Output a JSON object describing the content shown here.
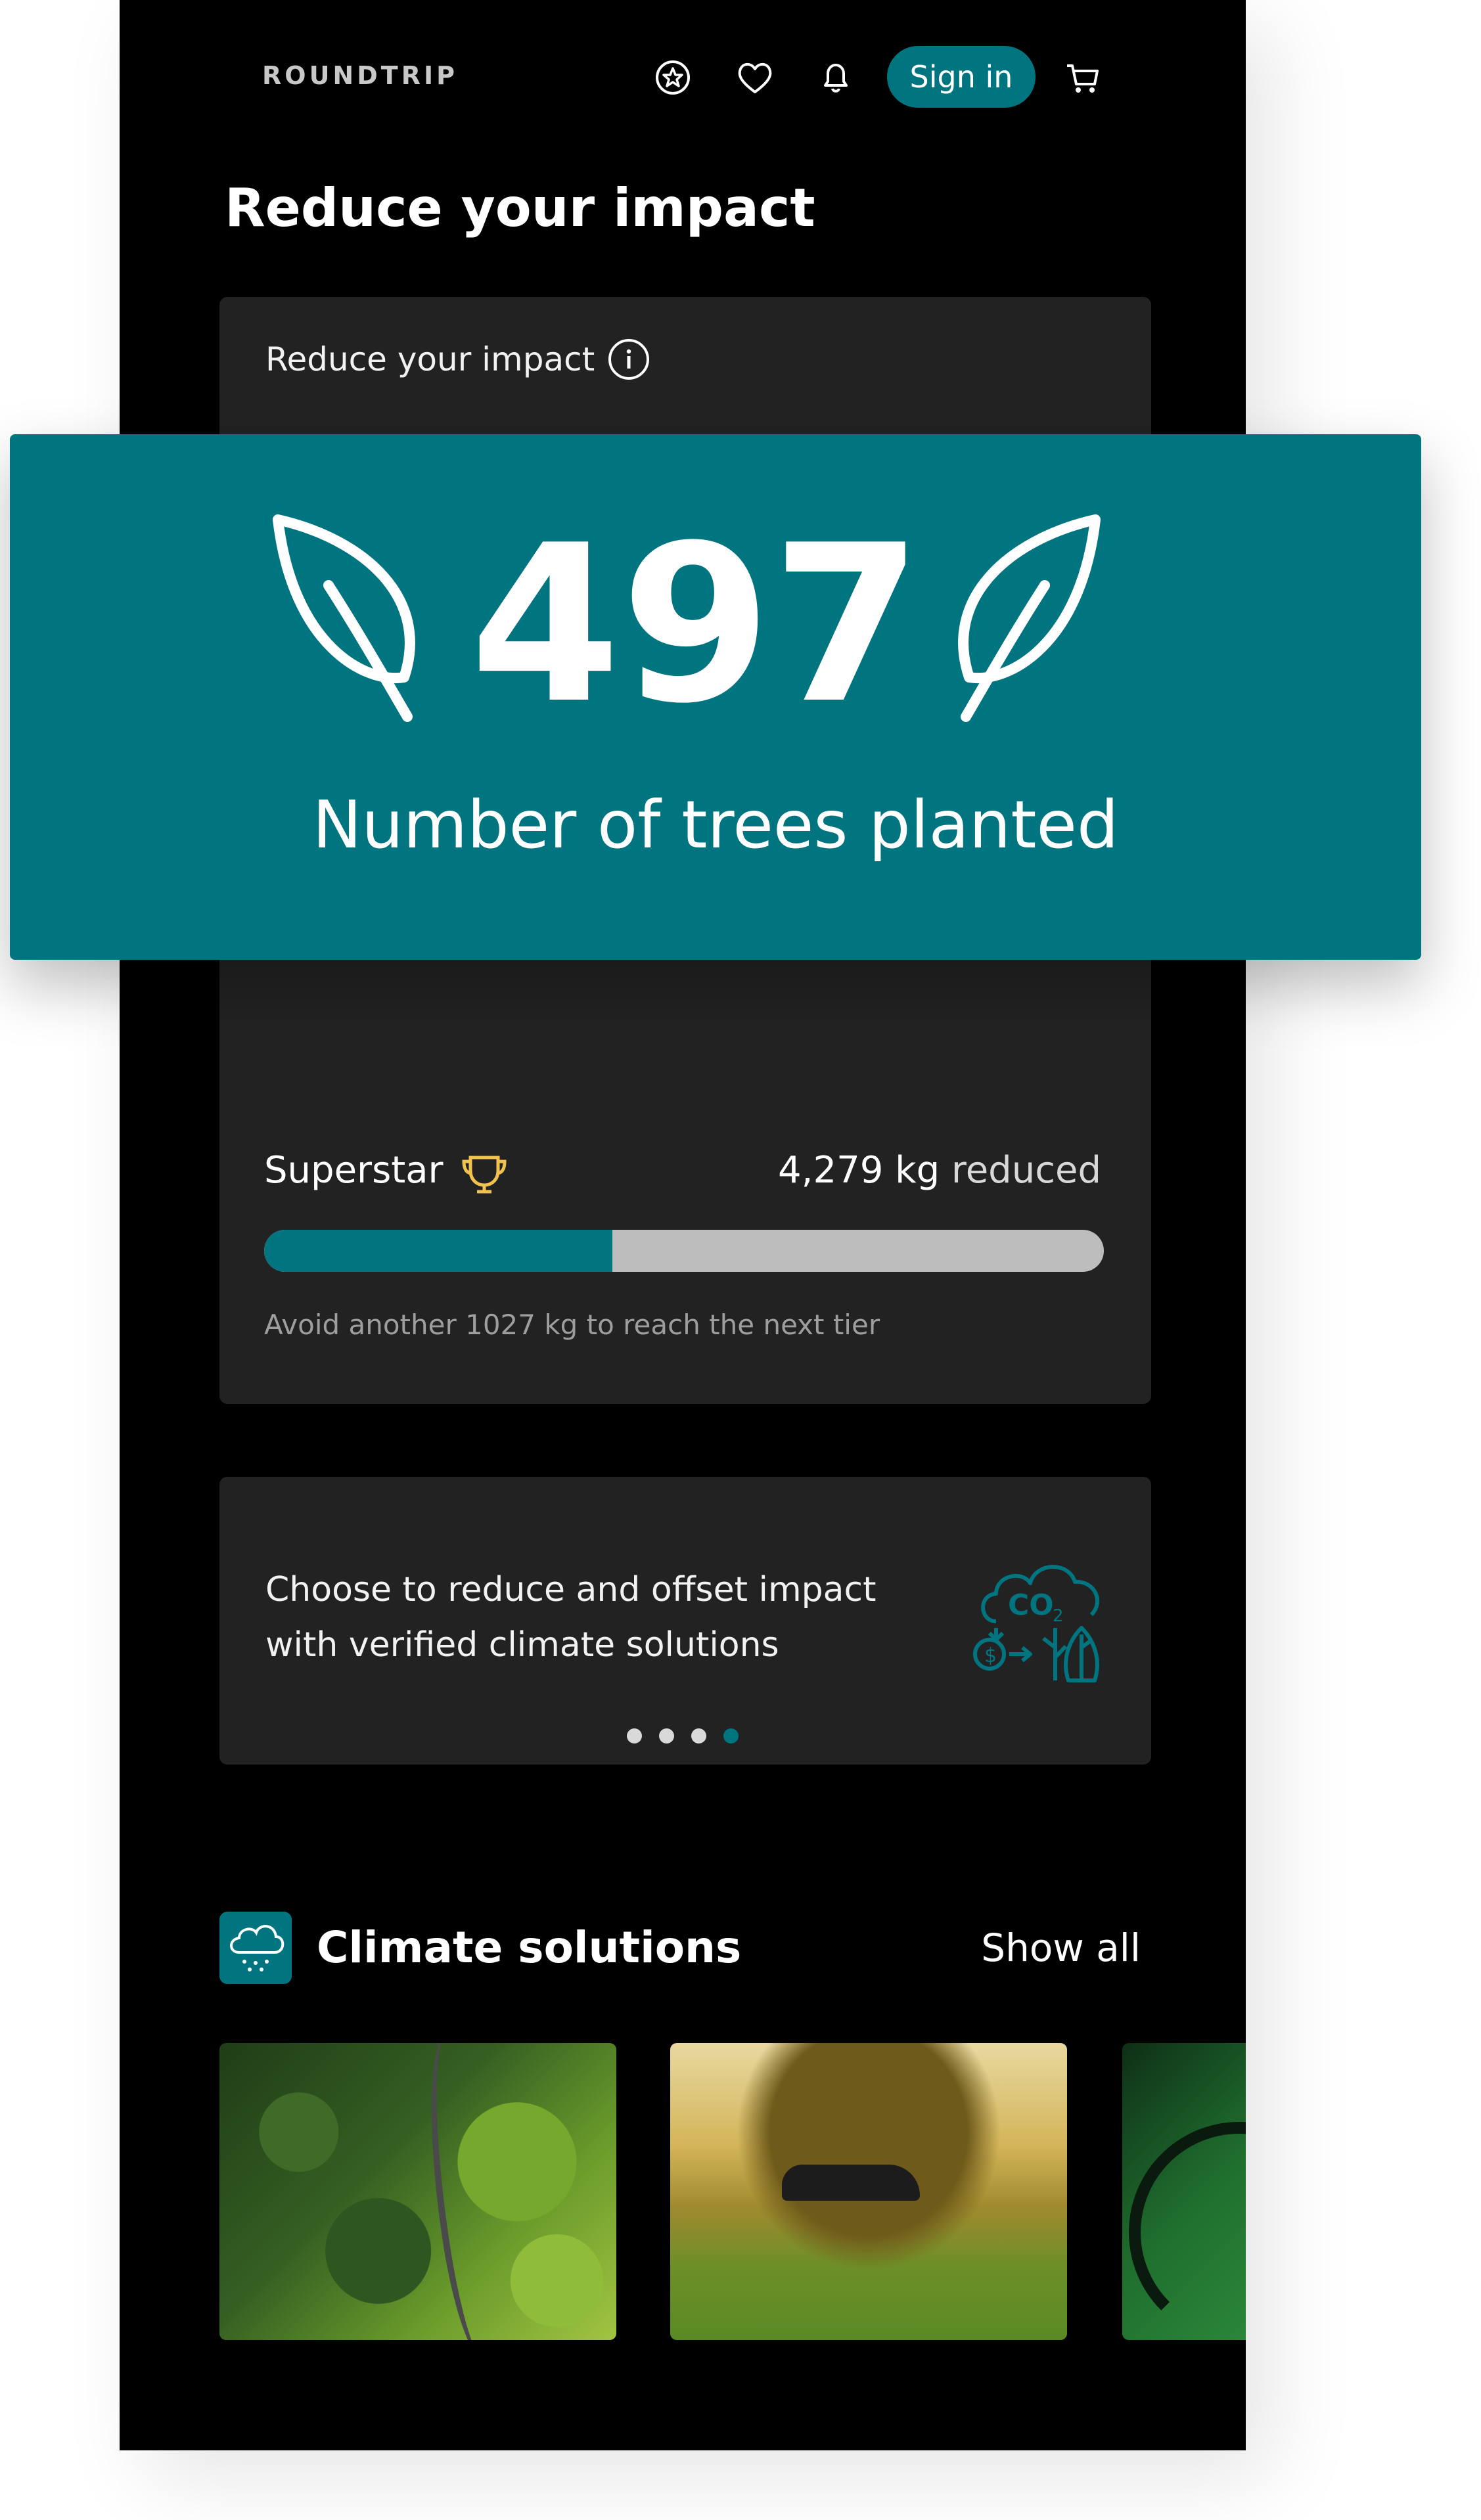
{
  "header": {
    "logo": "ROUNDTRIP",
    "signin_label": "Sign in"
  },
  "page": {
    "title": "Reduce your impact"
  },
  "impact_card": {
    "title": "Reduce your impact",
    "tier": "Superstar",
    "reduced_amount": "4,279 kg",
    "reduced_word": "reduced",
    "progress_fraction": 0.415,
    "next_tier_text": "Avoid another 1027 kg to reach the next tier"
  },
  "banner": {
    "value": "497",
    "label": "Number of trees planted"
  },
  "carousel": {
    "line1": "Choose to reduce and offset impact",
    "line2": "with verified climate solutions",
    "slide_count": 4,
    "active_slide": 4
  },
  "climate_solutions": {
    "title": "Climate solutions",
    "show_all": "Show all"
  },
  "colors": {
    "accent": "#007580",
    "background": "#000000",
    "card": "#222222",
    "progress_track": "#bdbdbd",
    "trophy": "#f2c14e"
  }
}
